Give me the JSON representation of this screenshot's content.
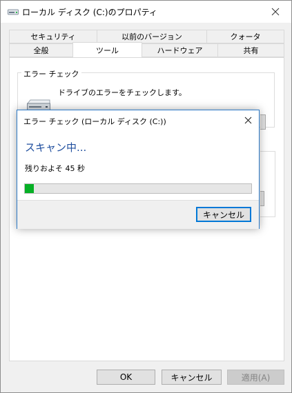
{
  "window": {
    "title": "ローカル ディスク (C:)のプロパティ"
  },
  "tabs": {
    "row1": [
      "セキュリティ",
      "以前のバージョン",
      "クォータ"
    ],
    "row2": [
      "全般",
      "ツール",
      "ハードウェア",
      "共有"
    ],
    "active": "ツール"
  },
  "error_check": {
    "group_label": "エラー チェック",
    "description": "ドライブのエラーをチェックします。"
  },
  "dialog": {
    "title": "エラー チェック (ローカル ディスク (C:))",
    "heading": "スキャン中...",
    "remaining": "残りおよそ 45 秒",
    "progress_fraction": 0.04,
    "cancel_label": "キャンセル"
  },
  "footer": {
    "ok_label": "OK",
    "cancel_label": "キャンセル",
    "apply_label": "適用(A)"
  },
  "colors": {
    "accent": "#0078d7",
    "heading": "#1f4e9e",
    "progress": "#06b025"
  }
}
